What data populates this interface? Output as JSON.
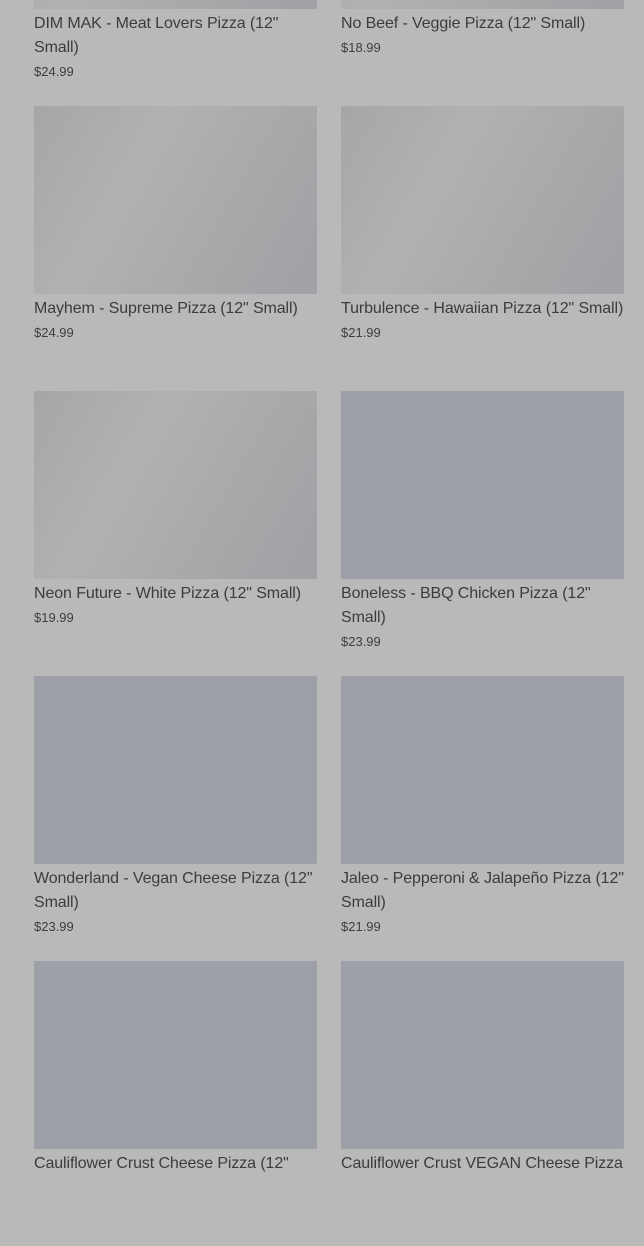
{
  "products": [
    {
      "name": "DIM MAK - Meat Lovers Pizza (12\" Small)",
      "price": "$24.99",
      "image": "photo"
    },
    {
      "name": "No Beef - Veggie Pizza (12\" Small)",
      "price": "$18.99",
      "image": "photo"
    },
    {
      "name": "Mayhem - Supreme Pizza (12\" Small)",
      "price": "$24.99",
      "image": "photo"
    },
    {
      "name": "Turbulence - Hawaiian Pizza (12\" Small)",
      "price": "$21.99",
      "image": "photo"
    },
    {
      "name": "Neon Future - White Pizza (12\" Small)",
      "price": "$19.99",
      "image": "photo"
    },
    {
      "name": "Boneless - BBQ Chicken Pizza (12\" Small)",
      "price": "$23.99",
      "image": "placeholder"
    },
    {
      "name": "Wonderland - Vegan Cheese Pizza (12\" Small)",
      "price": "$23.99",
      "image": "placeholder"
    },
    {
      "name": "Jaleo - Pepperoni & Jalapeño Pizza (12\" Small)",
      "price": "$21.99",
      "image": "placeholder"
    },
    {
      "name": "Cauliflower Crust Cheese Pizza (12\"",
      "price": "",
      "image": "placeholder"
    },
    {
      "name": "Cauliflower Crust VEGAN Cheese Pizza",
      "price": "",
      "image": "placeholder"
    }
  ]
}
